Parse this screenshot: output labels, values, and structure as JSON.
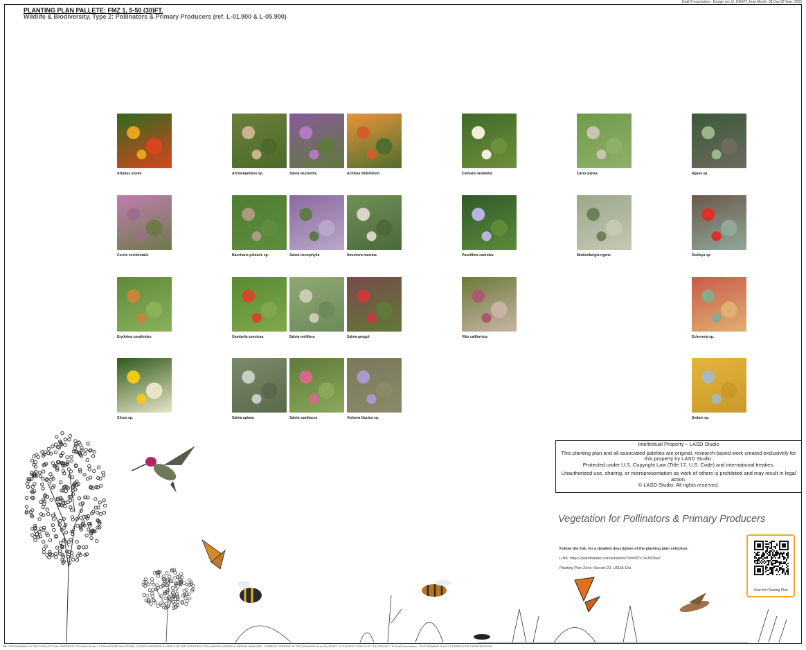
{
  "header": {
    "note": "Draft Presentation - Design ver.12_DRAFT, from Month: 08 Day 08 Year: 2025",
    "title": "PLANTING PLAN PALLETE: FMZ 1, 5-50 (30)FT.",
    "subtitle": "Wildlife & Biodiversity, Type 2: Pollinators & Primary Producers (ref. L-01.900 & L-05.900)"
  },
  "plants": [
    {
      "name": "Arbutus unedo",
      "colors": [
        "#2f6a1f",
        "#e9a21c",
        "#d9461e"
      ]
    },
    {
      "name": "Arctostaphylos sp.",
      "colors": [
        "#6b7f3a",
        "#c8b48a",
        "#4c6a2a"
      ]
    },
    {
      "name": "Salvia leucantha",
      "colors": [
        "#8a5a9c",
        "#b27bc1",
        "#5f7a3c"
      ]
    },
    {
      "name": "Achillea millefolium",
      "colors": [
        "#e9933a",
        "#d35e2a",
        "#4f6f2e"
      ]
    },
    {
      "name": "Clematis lasiantha",
      "colors": [
        "#3f6a2a",
        "#f3eed8",
        "#6f8f3a"
      ]
    },
    {
      "name": "Carex pansa",
      "colors": [
        "#6f9a4a",
        "#c9c3b0",
        "#8eb06a"
      ]
    },
    {
      "name": "Agave sp.",
      "colors": [
        "#3a5a3a",
        "#9ab58a",
        "#6e6a5e"
      ]
    },
    {
      "name": "Cercis occidentalis",
      "colors": [
        "#c07cb0",
        "#9a6d8c",
        "#6e7a4a"
      ]
    },
    {
      "name": "Baccharis pilularis sp.",
      "colors": [
        "#4f7f32",
        "#a99a80",
        "#5f8c3e"
      ]
    },
    {
      "name": "Salvia leucophylla",
      "colors": [
        "#8a6aa0",
        "#5f7a4a",
        "#b9a6c9"
      ]
    },
    {
      "name": "Heuchera maxima",
      "colors": [
        "#6f8f5a",
        "#d9d4c8",
        "#4c6a3a"
      ]
    },
    {
      "name": "Passiflora caerulea",
      "colors": [
        "#2f5a2a",
        "#b7b6e0",
        "#5f8a3a"
      ]
    },
    {
      "name": "Muhlenbergia rigens",
      "colors": [
        "#9aa88a",
        "#6f7f5a",
        "#c5c8b5"
      ]
    },
    {
      "name": "Dudleya sp.",
      "colors": [
        "#6a5a4a",
        "#d9302a",
        "#8fa89a"
      ]
    },
    {
      "name": "Erythrina coralloides",
      "colors": [
        "#5f8a3a",
        "#c9843a",
        "#8ab05a"
      ]
    },
    {
      "name": "Gambelia speciosa",
      "colors": [
        "#5a8a32",
        "#d04a2a",
        "#7fa84a"
      ]
    },
    {
      "name": "Salvia mellifera",
      "colors": [
        "#8fa874",
        "#c9ccb5",
        "#6e8a5a"
      ]
    },
    {
      "name": "Salvia greggii",
      "colors": [
        "#7a4a4a",
        "#c83a3a",
        "#5f7a3a"
      ]
    },
    {
      "name": "Vitis californica",
      "colors": [
        "#6a7a3a",
        "#a85a6a",
        "#c8b4a4"
      ]
    },
    {
      "name": "Echeveria sp.",
      "colors": [
        "#c95a4a",
        "#8aa88a",
        "#e0b070"
      ]
    },
    {
      "name": "Citrus sp.",
      "colors": [
        "#2f5a1a",
        "#f2c81a",
        "#e8e4c8"
      ]
    },
    {
      "name": "Salvia apiana",
      "colors": [
        "#7a8a6a",
        "#c9ccc4",
        "#5a6a4a"
      ]
    },
    {
      "name": "Salvia spathacea",
      "colors": [
        "#5f7a3a",
        "#d46a8a",
        "#8aa85a"
      ]
    },
    {
      "name": "Verbena lilacina sp.",
      "colors": [
        "#7a7a5a",
        "#a99ac9",
        "#8a8a6a"
      ]
    },
    {
      "name": "Sedum sp.",
      "colors": [
        "#e4b43a",
        "#a9b8c0",
        "#c99a2a"
      ]
    }
  ],
  "ip_notice": {
    "heading": "Intellectual Property – LASD Studio",
    "line1": "This planting plan and all associated palettes are original, research-based work created exclusively for this property by LASD Studio.",
    "line2": "Protected under U.S. Copyright Law (Title 17, U.S. Code) and international treaties.",
    "line3": "Unauthorized use, sharing, or misrepresentation as work of others is prohibited and may result in legal action.",
    "line4": "© LASD Studio. All rights reserved."
  },
  "vegetation_title": "Vegetation for Pollinators & Primary Producers",
  "link_info": {
    "follow": "Follow the link, for a detailed description of the planting plan selection:",
    "link": "LINK:  https://plantmaster.com/presents/?id=687c14c502ba7",
    "zone": "Planting Plan Zone: Sunset 23,  USDA 10a"
  },
  "qr": {
    "caption": "Scan for Planting Plan",
    "accent": "#f5a623"
  },
  "footer": "NB: THIS DRAWING IS THE INTELLECTUAL PROPERTY OF LASD Studio. IT CAN NOT BE MULTIPLIED, COPIED, MODIFIED & USED FOR THE CONSTRUCTION UNLESS AGREED & DESIGN FINALIZED.  CURRENT VERSION OF THE DRAWING IS ver.12_DRAFT, & CURRENT STATUS OF THE PROJECT IS Draft Presentation.  THIS DRAWING IS NOT A PERMIT FOR CONSTRUCTION."
}
